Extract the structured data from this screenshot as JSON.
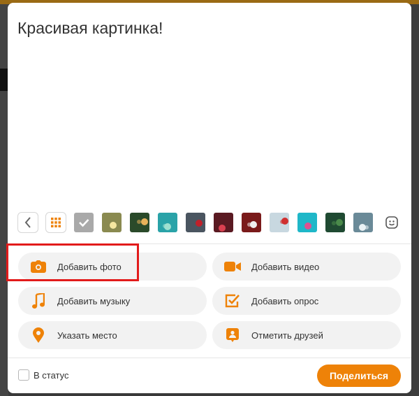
{
  "composer": {
    "text": "Красивая картинка!"
  },
  "strip": {
    "back_icon": "chevron-left-icon",
    "grid_icon": "grid-icon",
    "emoji_icon": "smile-icon",
    "thumbnails": [
      {
        "name": "checkmark-thumb",
        "bg": "#a9a9a9",
        "accent": "#ffffff"
      },
      {
        "name": "bokeh-lights",
        "bg": "#8a8a50",
        "accent": "#f5e7a0"
      },
      {
        "name": "christmas-tree",
        "bg": "#2a4a2a",
        "accent": "#e8b25a"
      },
      {
        "name": "teal-branches",
        "bg": "#2aa3a8",
        "accent": "#9ee0d0"
      },
      {
        "name": "red-bauble",
        "bg": "#4a5560",
        "accent": "#c0202a"
      },
      {
        "name": "red-ornaments",
        "bg": "#5a1a22",
        "accent": "#d94050"
      },
      {
        "name": "clock-ornament",
        "bg": "#7a1a1a",
        "accent": "#f0f0f0"
      },
      {
        "name": "gift-box",
        "bg": "#c8d8e0",
        "accent": "#d03030"
      },
      {
        "name": "turquoise-sparkle",
        "bg": "#1fb7c8",
        "accent": "#e05090"
      },
      {
        "name": "pine-branch",
        "bg": "#1f4a32",
        "accent": "#4a8a4a"
      },
      {
        "name": "frosted-branches",
        "bg": "#6a8a98",
        "accent": "#eaf2f5"
      }
    ]
  },
  "actions": {
    "add_photo": "Добавить фото",
    "add_video": "Добавить видео",
    "add_music": "Добавить музыку",
    "add_poll": "Добавить опрос",
    "add_place": "Указать место",
    "tag_friends": "Отметить друзей"
  },
  "footer": {
    "status_label": "В статус",
    "share_label": "Поделиться"
  },
  "colors": {
    "accent": "#ee8208",
    "icon": "#ee8208",
    "highlight": "#e21b1b"
  }
}
